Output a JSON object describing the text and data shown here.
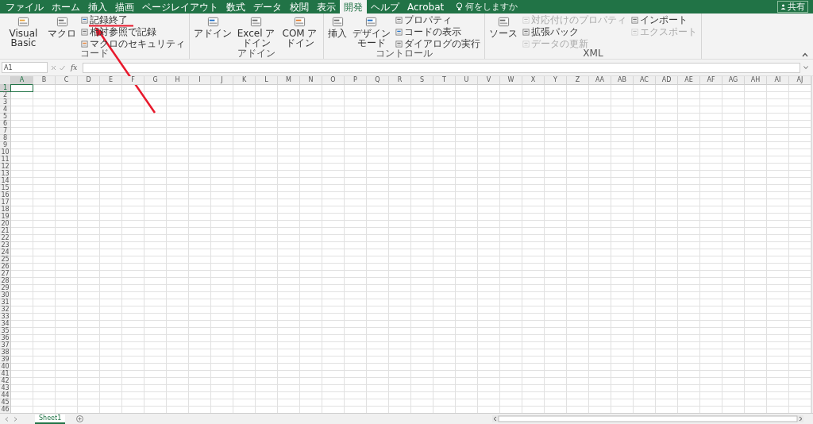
{
  "menu_tabs": [
    {
      "label": "ファイル",
      "selected": false
    },
    {
      "label": "ホーム",
      "selected": false
    },
    {
      "label": "挿入",
      "selected": false
    },
    {
      "label": "描画",
      "selected": false
    },
    {
      "label": "ページレイアウト",
      "selected": false
    },
    {
      "label": "数式",
      "selected": false
    },
    {
      "label": "データ",
      "selected": false
    },
    {
      "label": "校閲",
      "selected": false
    },
    {
      "label": "表示",
      "selected": false
    },
    {
      "label": "開発",
      "selected": true
    },
    {
      "label": "ヘルプ",
      "selected": false
    },
    {
      "label": "Acrobat",
      "selected": false
    }
  ],
  "tell_me": {
    "placeholder": "何をしますか"
  },
  "share_button": {
    "label": "共有"
  },
  "ribbon_groups": [
    {
      "label": "コード",
      "items": [
        {
          "kind": "large",
          "label": "Visual Basic",
          "disabled": false
        },
        {
          "kind": "large",
          "label": "マクロ",
          "disabled": false
        },
        {
          "kind": "stack",
          "entries": [
            {
              "label": "記録終了",
              "disabled": false
            },
            {
              "label": "相対参照で記録",
              "disabled": false
            },
            {
              "label": "マクロのセキュリティ",
              "disabled": false
            }
          ]
        }
      ]
    },
    {
      "label": "アドイン",
      "items": [
        {
          "kind": "large",
          "label": "アドイン",
          "disabled": false
        },
        {
          "kind": "large",
          "label": "Excel アドイン",
          "disabled": false
        },
        {
          "kind": "large",
          "label": "COM アドイン",
          "disabled": false
        }
      ]
    },
    {
      "label": "コントロール",
      "items": [
        {
          "kind": "large",
          "label": "挿入",
          "disabled": false
        },
        {
          "kind": "large",
          "label": "デザインモード",
          "disabled": false
        },
        {
          "kind": "stack",
          "entries": [
            {
              "label": "プロパティ",
              "disabled": false
            },
            {
              "label": "コードの表示",
              "disabled": false
            },
            {
              "label": "ダイアログの実行",
              "disabled": false
            }
          ]
        }
      ]
    },
    {
      "label": "XML",
      "items": [
        {
          "kind": "large",
          "label": "ソース",
          "disabled": false
        },
        {
          "kind": "stack",
          "entries": [
            {
              "label": "対応付けのプロパティ",
              "disabled": true
            },
            {
              "label": "拡張パック",
              "disabled": false
            },
            {
              "label": "データの更新",
              "disabled": true
            }
          ]
        },
        {
          "kind": "stack",
          "entries": [
            {
              "label": "インポート",
              "disabled": false
            },
            {
              "label": "エクスポート",
              "disabled": true
            }
          ]
        }
      ]
    }
  ],
  "formula_bar": {
    "name_box": "A1",
    "insert_function": "fx"
  },
  "columns": [
    {
      "label": "A",
      "selected": true
    },
    {
      "label": "B",
      "selected": false
    },
    {
      "label": "C",
      "selected": false
    },
    {
      "label": "D",
      "selected": false
    },
    {
      "label": "E",
      "selected": false
    },
    {
      "label": "F",
      "selected": false
    },
    {
      "label": "G",
      "selected": false
    },
    {
      "label": "H",
      "selected": false
    },
    {
      "label": "I",
      "selected": false
    },
    {
      "label": "J",
      "selected": false
    },
    {
      "label": "K",
      "selected": false
    },
    {
      "label": "L",
      "selected": false
    },
    {
      "label": "M",
      "selected": false
    },
    {
      "label": "N",
      "selected": false
    },
    {
      "label": "O",
      "selected": false
    },
    {
      "label": "P",
      "selected": false
    },
    {
      "label": "Q",
      "selected": false
    },
    {
      "label": "R",
      "selected": false
    },
    {
      "label": "S",
      "selected": false
    },
    {
      "label": "T",
      "selected": false
    },
    {
      "label": "U",
      "selected": false
    },
    {
      "label": "V",
      "selected": false
    },
    {
      "label": "W",
      "selected": false
    },
    {
      "label": "X",
      "selected": false
    },
    {
      "label": "Y",
      "selected": false
    },
    {
      "label": "Z",
      "selected": false
    },
    {
      "label": "AA",
      "selected": false
    },
    {
      "label": "AB",
      "selected": false
    },
    {
      "label": "AC",
      "selected": false
    },
    {
      "label": "AD",
      "selected": false
    },
    {
      "label": "AE",
      "selected": false
    },
    {
      "label": "AF",
      "selected": false
    },
    {
      "label": "AG",
      "selected": false
    },
    {
      "label": "AH",
      "selected": false
    },
    {
      "label": "AI",
      "selected": false
    },
    {
      "label": "AJ",
      "selected": false
    }
  ],
  "rows": [
    {
      "label": "1",
      "selected": true
    },
    {
      "label": "2",
      "selected": false
    },
    {
      "label": "3",
      "selected": false
    },
    {
      "label": "4",
      "selected": false
    },
    {
      "label": "5",
      "selected": false
    },
    {
      "label": "6",
      "selected": false
    },
    {
      "label": "7",
      "selected": false
    },
    {
      "label": "8",
      "selected": false
    },
    {
      "label": "9",
      "selected": false
    },
    {
      "label": "10",
      "selected": false
    },
    {
      "label": "11",
      "selected": false
    },
    {
      "label": "12",
      "selected": false
    },
    {
      "label": "13",
      "selected": false
    },
    {
      "label": "14",
      "selected": false
    },
    {
      "label": "15",
      "selected": false
    },
    {
      "label": "16",
      "selected": false
    },
    {
      "label": "17",
      "selected": false
    },
    {
      "label": "18",
      "selected": false
    },
    {
      "label": "19",
      "selected": false
    },
    {
      "label": "20",
      "selected": false
    },
    {
      "label": "21",
      "selected": false
    },
    {
      "label": "22",
      "selected": false
    },
    {
      "label": "23",
      "selected": false
    },
    {
      "label": "24",
      "selected": false
    },
    {
      "label": "25",
      "selected": false
    },
    {
      "label": "26",
      "selected": false
    },
    {
      "label": "27",
      "selected": false
    },
    {
      "label": "28",
      "selected": false
    },
    {
      "label": "29",
      "selected": false
    },
    {
      "label": "30",
      "selected": false
    },
    {
      "label": "31",
      "selected": false
    },
    {
      "label": "32",
      "selected": false
    },
    {
      "label": "33",
      "selected": false
    },
    {
      "label": "34",
      "selected": false
    },
    {
      "label": "35",
      "selected": false
    },
    {
      "label": "36",
      "selected": false
    },
    {
      "label": "37",
      "selected": false
    },
    {
      "label": "38",
      "selected": false
    },
    {
      "label": "39",
      "selected": false
    },
    {
      "label": "40",
      "selected": false
    },
    {
      "label": "41",
      "selected": false
    },
    {
      "label": "42",
      "selected": false
    },
    {
      "label": "43",
      "selected": false
    },
    {
      "label": "44",
      "selected": false
    },
    {
      "label": "45",
      "selected": false
    },
    {
      "label": "46",
      "selected": false
    }
  ],
  "sheet_tabs": [
    {
      "label": "Sheet1",
      "selected": true
    }
  ]
}
